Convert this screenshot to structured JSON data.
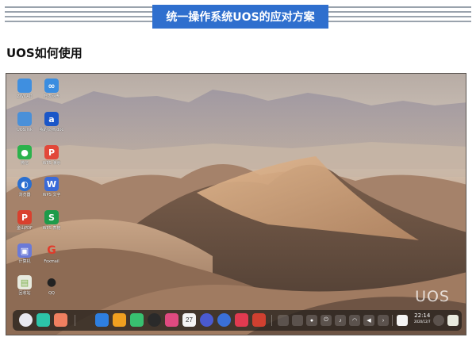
{
  "header": {
    "title": "统一操作系统UOS的应对方案"
  },
  "section": {
    "heading": "UOS如何使用"
  },
  "desktop": {
    "logo_text": "UOS",
    "icons": [
      {
        "label": "ZWCAD",
        "icon": "folder-icon",
        "color": "#3f8fe0",
        "glyph": ""
      },
      {
        "label": "万发网盘",
        "icon": "cloud-drive-icon",
        "color": "#3a8de0",
        "glyph": "∞"
      },
      {
        "label": "UOS.lnk",
        "icon": "document-icon",
        "color": "#4a90d9",
        "glyph": ""
      },
      {
        "label": "我的文档.doc",
        "icon": "word-doc-icon",
        "color": "#1a56c8",
        "glyph": "a"
      },
      {
        "label": "微信",
        "icon": "wechat-icon",
        "color": "#2bb24c",
        "glyph": "●"
      },
      {
        "label": "WPS 演示",
        "icon": "wps-presentation-icon",
        "color": "#e2483a",
        "glyph": "P"
      },
      {
        "label": "浏览器",
        "icon": "browser-icon",
        "color": "#2a6fd0",
        "glyph": "◐"
      },
      {
        "label": "WPS 文字",
        "icon": "wps-writer-icon",
        "color": "#3a6ad8",
        "glyph": "W"
      },
      {
        "label": "金山PDF",
        "icon": "pdf-icon",
        "color": "#d9402e",
        "glyph": "P"
      },
      {
        "label": "WPS 表格",
        "icon": "wps-spreadsheet-icon",
        "color": "#1e9b4a",
        "glyph": "S"
      },
      {
        "label": "计算机",
        "icon": "computer-icon",
        "color": "#6a7ad8",
        "glyph": "▣"
      },
      {
        "label": "Foxmail",
        "icon": "foxmail-icon",
        "color": "#e23a2a",
        "glyph": "G"
      },
      {
        "label": "回收站",
        "icon": "trash-icon",
        "color": "#7ab04a",
        "glyph": "▤"
      },
      {
        "label": "QQ",
        "icon": "qq-icon",
        "color": "#222222",
        "glyph": "●"
      }
    ]
  },
  "dock": {
    "time": "22:14",
    "date": "2020/12/7",
    "calendar_day": "27",
    "apps": [
      {
        "icon": "launcher-icon",
        "color": "#e8e8f0"
      },
      {
        "icon": "multitask-icon",
        "color": "#2cc4a8"
      },
      {
        "icon": "workspace-icon",
        "color": "#f08060"
      },
      {
        "icon": "app-store-icon",
        "color": "#2e7fe0"
      },
      {
        "icon": "file-manager-icon",
        "color": "#f0a020"
      },
      {
        "icon": "music-icon",
        "color": "#38c070"
      },
      {
        "icon": "video-icon",
        "color": "#2a2a2a"
      },
      {
        "icon": "image-viewer-icon",
        "color": "#e04a80"
      },
      {
        "icon": "calendar-icon",
        "color": "#f4f4f4"
      },
      {
        "icon": "settings-icon",
        "color": "#4a5ad0"
      },
      {
        "icon": "browser-icon",
        "color": "#3a70d8"
      },
      {
        "icon": "voice-icon",
        "color": "#e03a50"
      },
      {
        "icon": "screen-recorder-icon",
        "color": "#d04030"
      }
    ]
  }
}
